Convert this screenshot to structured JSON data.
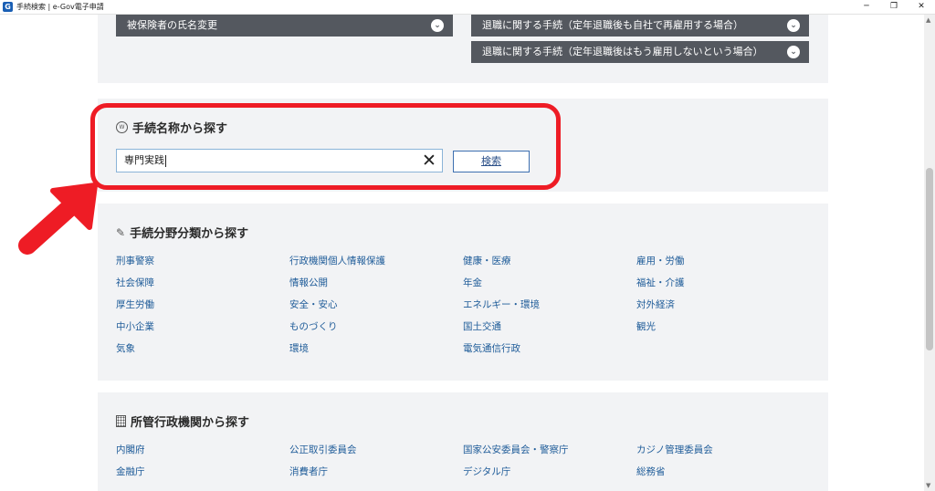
{
  "window": {
    "title": "手続検索 | e-Gov電子申請",
    "app_icon": "G",
    "minimize": "─",
    "restore": "❐",
    "close": "✕"
  },
  "top_buttons": [
    "被保険者の氏名変更",
    "退職に関する手続（定年退職後も自社で再雇用する場合）",
    "退職に関する手続（定年退職後はもう雇用しないという場合）"
  ],
  "search_section": {
    "title": "手続名称から探す",
    "input_value": "専門実践",
    "clear_label": "✕",
    "search_button": "検索"
  },
  "field_section": {
    "title": "手続分野分類から探す",
    "columns": [
      [
        "刑事警察",
        "社会保障",
        "厚生労働",
        "中小企業",
        "気象"
      ],
      [
        "行政機関個人情報保護",
        "情報公開",
        "安全・安心",
        "ものづくり",
        "環境"
      ],
      [
        "健康・医療",
        "年金",
        "エネルギー・環境",
        "国土交通",
        "電気通信行政"
      ],
      [
        "雇用・労働",
        "福祉・介護",
        "対外経済",
        "観光"
      ]
    ]
  },
  "agency_section": {
    "title": "所管行政機関から探す",
    "columns": [
      [
        "内閣府",
        "金融庁"
      ],
      [
        "公正取引委員会",
        "消費者庁"
      ],
      [
        "国家公安委員会・警察庁",
        "デジタル庁"
      ],
      [
        "カジノ管理委員会",
        "総務省"
      ]
    ]
  },
  "colors": {
    "highlight": "#ee1c25",
    "button_dark": "#54585f",
    "link": "#1f5c99",
    "panel_bg": "#f2f3f5"
  }
}
